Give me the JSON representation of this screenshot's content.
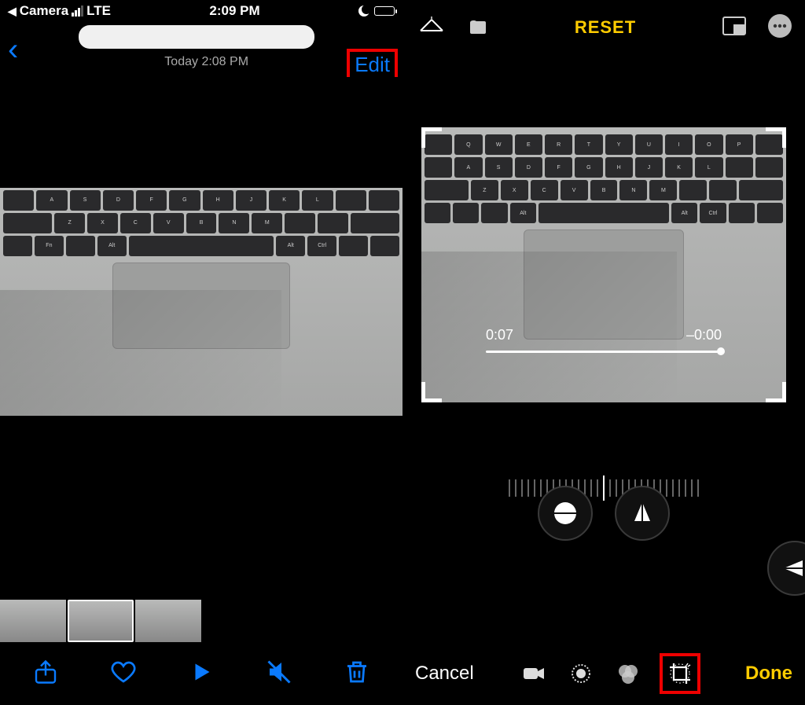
{
  "left": {
    "status": {
      "back_app": "Camera",
      "carrier": "LTE",
      "time": "2:09 PM"
    },
    "header": {
      "timestamp": "Today  2:08 PM",
      "edit_label": "Edit"
    },
    "toolbar": {
      "share": "Share",
      "favorite": "Favorite",
      "play": "Play",
      "mute": "Mute",
      "delete": "Delete"
    }
  },
  "right": {
    "top": {
      "flip": "Flip",
      "aspect": "Aspect",
      "reset_label": "RESET",
      "pip": "Picture in Picture",
      "more": "More"
    },
    "playback": {
      "elapsed": "0:07",
      "remaining": "–0:00"
    },
    "orient": {
      "straighten": "Straighten",
      "horizontal": "Horizontal",
      "vertical": "Vertical"
    },
    "bottom": {
      "cancel_label": "Cancel",
      "done_label": "Done",
      "modes": {
        "video": "Video",
        "adjust": "Adjust",
        "filters": "Filters",
        "crop": "Crop"
      }
    }
  }
}
